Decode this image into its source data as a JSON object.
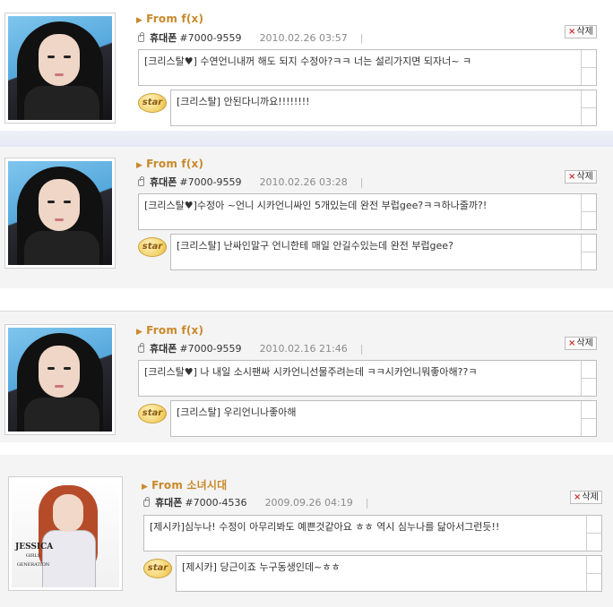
{
  "posts": [
    {
      "from": "From f(x)",
      "phone_label": "휴대폰",
      "phone_number": "#7000-9559",
      "date": "2010.02.26 03:57",
      "delete_label": "삭제",
      "message": "[크리스탈♥] 수연언니내꺼 해도 되지 수정아?ㅋㅋ 너는 설리가지면 되자너~ ㅋ",
      "star_label": "star",
      "reply": "[크리스탈] 안된다니까요!!!!!!!!"
    },
    {
      "from": "From f(x)",
      "phone_label": "휴대폰",
      "phone_number": "#7000-9559",
      "date": "2010.02.26 03:28",
      "delete_label": "삭제",
      "message": "[크리스탈♥]수정아 ~언니 시카언니싸인 5개있는데 완전 부럽gee?ㅋㅋ하나줄까?!",
      "star_label": "star",
      "reply": "[크리스탈] 난싸인말구 언니한테 매일 안길수있는데 완전 부럽gee?"
    },
    {
      "from": "From f(x)",
      "phone_label": "휴대폰",
      "phone_number": "#7000-9559",
      "date": "2010.02.16 21:46",
      "delete_label": "삭제",
      "message": "[크리스탈♥] 나 내일 소시팬싸  시카언니선물주려는데 ㅋㅋ시카언니뭐좋아해??ㅋ",
      "star_label": "star",
      "reply": "[크리스탈] 우리언니나좋아해"
    },
    {
      "from": "From 소녀시대",
      "phone_label": "휴대폰",
      "phone_number": "#7000-4536",
      "date": "2009.09.26 04:19",
      "delete_label": "삭제",
      "message": "[제시카]심누나! 수정이 아무리봐도 예쁜것같아요 ㅎㅎ 역시 심누나를 닮아서그런듯!!",
      "star_label": "star",
      "reply": "[제시카] 당근이죠 누구동생인데~ㅎㅎ",
      "avatar_logo": "JESSICA",
      "avatar_logo_sub": "GIRLS GENERATION"
    }
  ],
  "colors": {
    "from_text": "#c9892a",
    "border": "#bdbdbd",
    "card_bg": "#f4f4f4"
  }
}
